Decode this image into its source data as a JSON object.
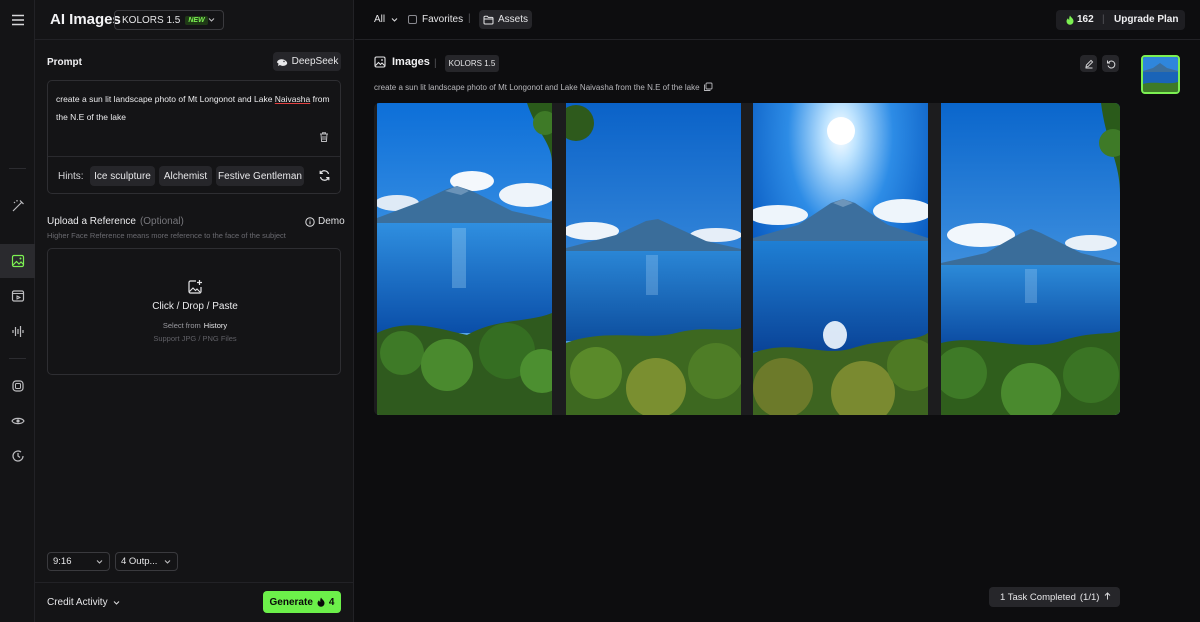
{
  "panel": {
    "title": "AI Images",
    "model_select": {
      "value": "KOLORS 1.5",
      "badge": "NEW"
    },
    "prompt_label": "Prompt",
    "deepseek_label": "DeepSeek",
    "prompt": {
      "part1": "create a sun lit landscape photo of Mt Longonot and Lake ",
      "misspelled": "Naivasha",
      "part2": " from the N.E of the lake"
    },
    "hints": {
      "label": "Hints:",
      "chips": [
        "Ice sculpture",
        "Alchemist",
        "Festive Gentleman"
      ]
    },
    "upload": {
      "title": "Upload a Reference",
      "optional": "(Optional)",
      "demo": "Demo",
      "subtitle": "Higher Face Reference means more reference to the face of the subject",
      "drop_main": "Click / Drop / Paste",
      "select_from": "Select from",
      "history": "History",
      "support": "Support JPG / PNG Files"
    },
    "aspect_ratio": "9:16",
    "outputs": "4 Outp...",
    "credit_activity": "Credit Activity",
    "generate": {
      "label": "Generate",
      "cost": "4"
    }
  },
  "topbar": {
    "filter_all": "All",
    "favorites": "Favorites",
    "separator": "|",
    "assets": "Assets",
    "credits": "162",
    "upgrade": "Upgrade Plan"
  },
  "main": {
    "section_title": "Images",
    "model_tag": "KOLORS 1.5",
    "prompt": "create a sun lit landscape photo of Mt Longonot and Lake Naivasha from the N.E of the lake",
    "task_status": "1 Task Completed",
    "task_count": "(1/1)"
  },
  "colors": {
    "accent": "#6cf04a",
    "background": "#0d0d0f",
    "panel": "#141416"
  },
  "icons": [
    "menu-icon",
    "magic-wand-icon",
    "image-icon",
    "video-icon",
    "audio-icon",
    "cube-icon",
    "eye-icon",
    "clock-icon",
    "deepseek-whale-icon",
    "trash-icon",
    "refresh-icon",
    "info-icon",
    "image-add-icon",
    "chevron-down-icon",
    "folder-icon",
    "flame-icon",
    "edit-icon",
    "undo-icon",
    "copy-icon",
    "arrow-up-icon"
  ]
}
